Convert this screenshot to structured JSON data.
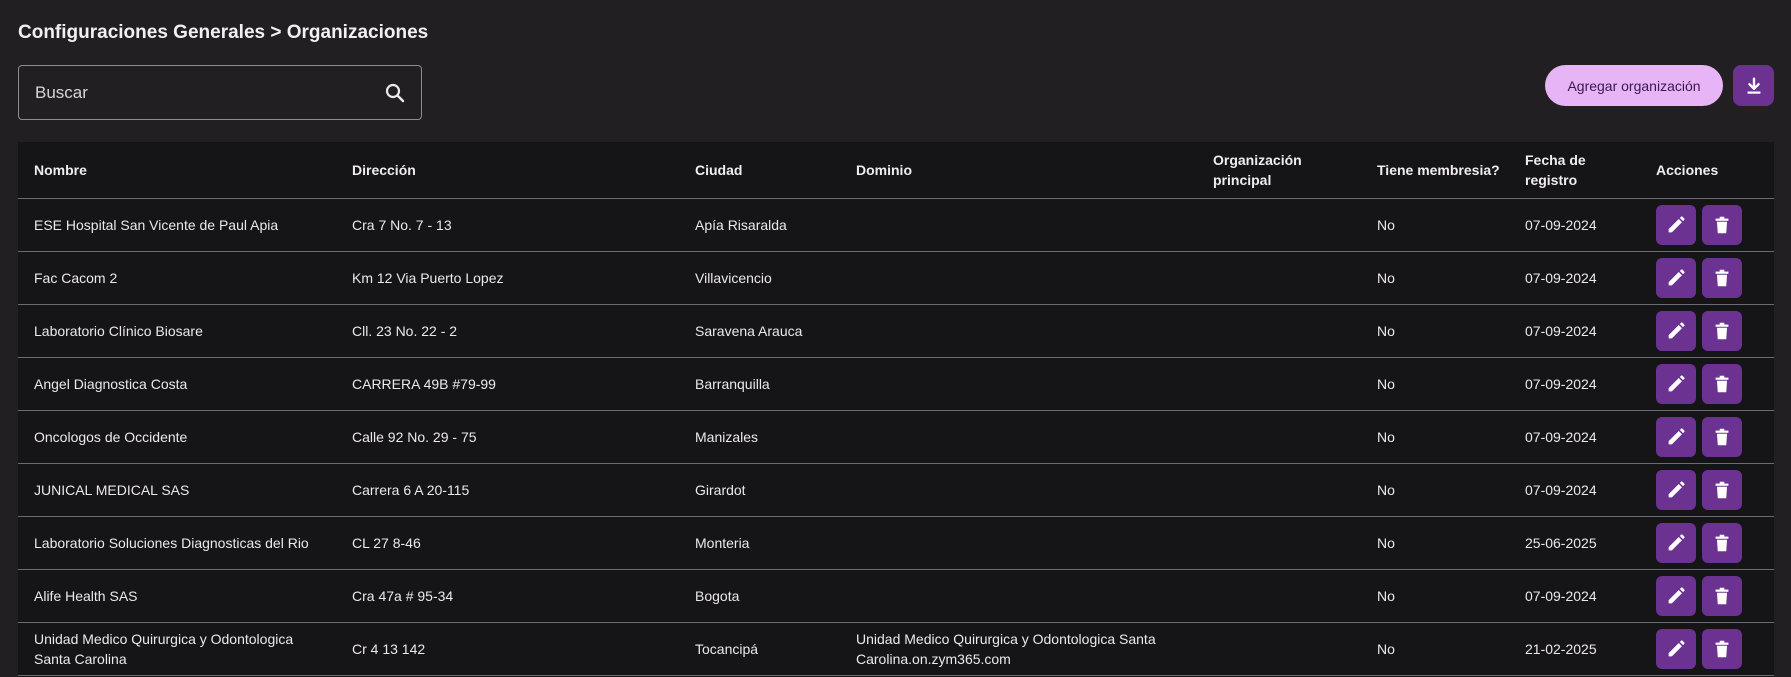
{
  "breadcrumb": "Configuraciones Generales > Organizaciones",
  "search": {
    "placeholder": "Buscar",
    "value": ""
  },
  "toolbar": {
    "add_label": "Agregar organización"
  },
  "icons": {
    "search": "search-icon",
    "download": "download-icon",
    "edit": "pencil-icon",
    "delete": "trash-icon"
  },
  "colors": {
    "accent": "#6b3291",
    "add_button": "#e7b5f6"
  },
  "table": {
    "headers": {
      "nombre": "Nombre",
      "direccion": "Dirección",
      "ciudad": "Ciudad",
      "dominio": "Dominio",
      "org_principal": "Organización principal",
      "membresia": "Tiene membresia?",
      "fecha": "Fecha de registro",
      "acciones": "Acciones"
    },
    "rows": [
      {
        "nombre": "ESE Hospital San Vicente de Paul Apia",
        "direccion": "Cra 7 No. 7 - 13",
        "ciudad": "Apía Risaralda",
        "dominio": "",
        "org_principal": "",
        "membresia": "No",
        "fecha": "07-09-2024"
      },
      {
        "nombre": "Fac Cacom 2",
        "direccion": "Km 12 Via Puerto Lopez",
        "ciudad": "Villavicencio",
        "dominio": "",
        "org_principal": "",
        "membresia": "No",
        "fecha": "07-09-2024"
      },
      {
        "nombre": "Laboratorio Clínico Biosare",
        "direccion": "Cll. 23 No. 22 - 2",
        "ciudad": "Saravena Arauca",
        "dominio": "",
        "org_principal": "",
        "membresia": "No",
        "fecha": "07-09-2024"
      },
      {
        "nombre": "Angel Diagnostica Costa",
        "direccion": "CARRERA 49B #79-99",
        "ciudad": "Barranquilla",
        "dominio": "",
        "org_principal": "",
        "membresia": "No",
        "fecha": "07-09-2024"
      },
      {
        "nombre": "Oncologos de Occidente",
        "direccion": "Calle 92 No. 29 - 75",
        "ciudad": "Manizales",
        "dominio": "",
        "org_principal": "",
        "membresia": "No",
        "fecha": "07-09-2024"
      },
      {
        "nombre": "JUNICAL MEDICAL SAS",
        "direccion": "Carrera 6 A 20-115",
        "ciudad": "Girardot",
        "dominio": "",
        "org_principal": "",
        "membresia": "No",
        "fecha": "07-09-2024"
      },
      {
        "nombre": "Laboratorio Soluciones Diagnosticas del Rio",
        "direccion": "CL 27 8-46",
        "ciudad": "Monteria",
        "dominio": "",
        "org_principal": "",
        "membresia": "No",
        "fecha": "25-06-2025"
      },
      {
        "nombre": "Alife Health SAS",
        "direccion": "Cra 47a # 95-34",
        "ciudad": "Bogota",
        "dominio": "",
        "org_principal": "",
        "membresia": "No",
        "fecha": "07-09-2024"
      },
      {
        "nombre": "Unidad Medico Quirurgica y Odontologica Santa Carolina",
        "direccion": "Cr 4 13 142",
        "ciudad": "Tocancipá",
        "dominio": "Unidad Medico Quirurgica y Odontologica Santa Carolina.on.zym365.com",
        "org_principal": "",
        "membresia": "No",
        "fecha": "21-02-2025"
      }
    ]
  }
}
